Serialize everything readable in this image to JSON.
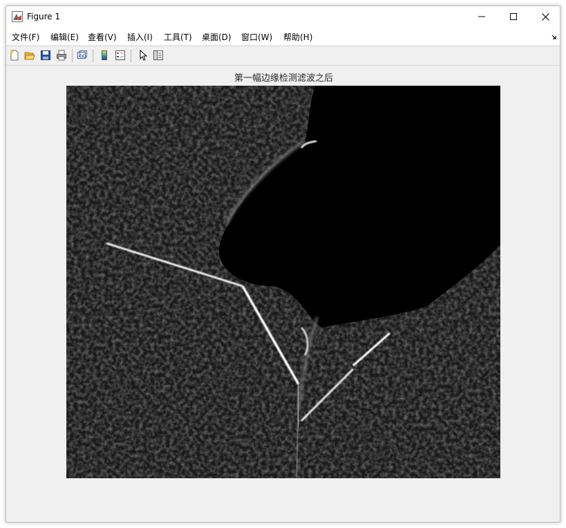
{
  "window": {
    "title": "Figure 1",
    "icon": "matlab-figure-icon",
    "controls": [
      "minimize-icon",
      "maximize-icon",
      "close-icon"
    ]
  },
  "menubar": {
    "items": [
      {
        "label": "文件(F)"
      },
      {
        "label": "编辑(E)"
      },
      {
        "label": "查看(V)"
      },
      {
        "label": "插入(I)"
      },
      {
        "label": "工具(T)"
      },
      {
        "label": "桌面(D)"
      },
      {
        "label": "窗口(W)"
      },
      {
        "label": "帮助(H)"
      }
    ],
    "dock_icon": "dock-arrow-icon"
  },
  "toolbar": {
    "buttons": [
      "new-figure-icon",
      "open-file-icon",
      "save-icon",
      "print-icon",
      "link-plot-icon",
      "colorbar-icon",
      "legend-icon",
      "pointer-icon",
      "property-inspector-icon"
    ]
  },
  "figure": {
    "title": "第一幅边缘检测滤波之后",
    "image": {
      "description_icon": "edge-filtered-grayscale-image",
      "background": "#000000"
    }
  },
  "colors": {
    "window_bg": "#f0f0f0",
    "titlebar_bg": "#ffffff",
    "text": "#000000"
  }
}
